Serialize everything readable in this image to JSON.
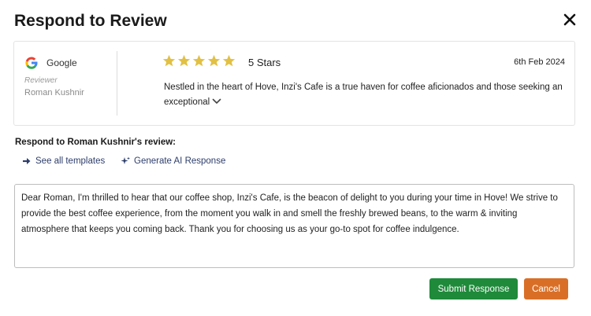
{
  "dialog": {
    "title": "Respond to Review",
    "close_icon": "close-icon"
  },
  "review": {
    "platform": "Google",
    "platform_icon": "google-logo-icon",
    "reviewer_caption": "Reviewer",
    "reviewer_name": "Roman Kushnir",
    "rating": 5,
    "rating_max": 5,
    "star_color": "#e2c043",
    "rating_label": "5 Stars",
    "date": "6th Feb 2024",
    "text": "Nestled in the heart of Hove, Inzi's Cafe is a true haven for coffee aficionados and those seeking an exceptional",
    "expand_icon": "chevron-down-icon"
  },
  "response": {
    "label": "Respond to Roman Kushnir's review:",
    "templates_link": "See all templates",
    "templates_icon": "arrow-right-icon",
    "ai_link": "Generate AI Response",
    "ai_icon": "sparkle-icon",
    "text": "Dear Roman, I'm thrilled to hear that our coffee shop, Inzi's Cafe, is the beacon of delight to you during your time in Hove! We strive to provide the best coffee experience, from the moment you walk in and smell the freshly brewed beans, to the warm & inviting atmosphere that keeps you coming back. Thank you for choosing us as your go-to spot for coffee indulgence."
  },
  "actions": {
    "submit_label": "Submit Response",
    "submit_color": "#1e8a3a",
    "cancel_label": "Cancel",
    "cancel_color": "#d96f27"
  }
}
